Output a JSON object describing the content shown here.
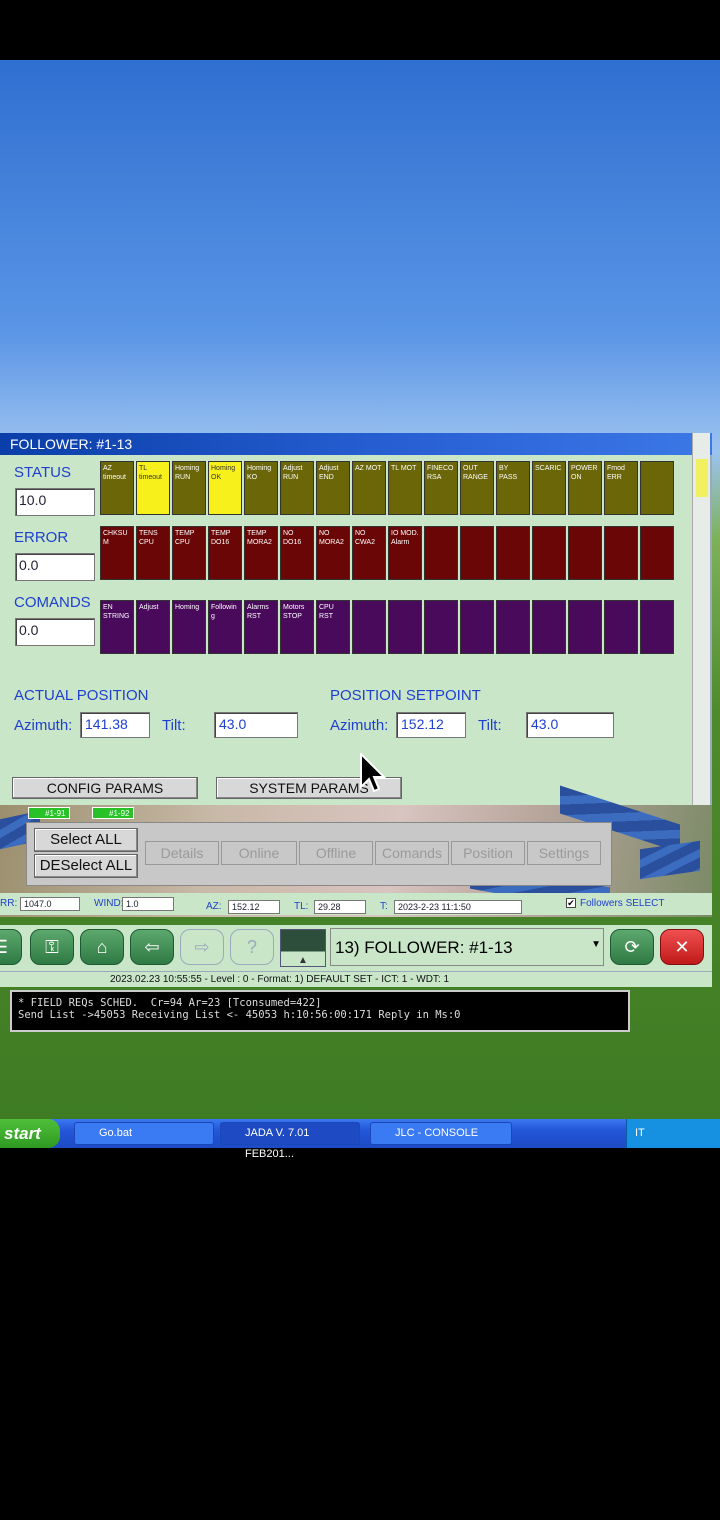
{
  "window": {
    "title": "FOLLOWER: #1-13"
  },
  "status": {
    "label": "STATUS",
    "value": "10.0",
    "cells": [
      {
        "text": "AZ timeout",
        "on": false
      },
      {
        "text": "TL timeout",
        "on": true
      },
      {
        "text": "Homing RUN",
        "on": false
      },
      {
        "text": "Homing OK",
        "on": true
      },
      {
        "text": "Homing KO",
        "on": false
      },
      {
        "text": "Adjust RUN",
        "on": false
      },
      {
        "text": "Adjust END",
        "on": false
      },
      {
        "text": "AZ MOT",
        "on": false
      },
      {
        "text": "TL MOT",
        "on": false
      },
      {
        "text": "FINECO RSA",
        "on": false
      },
      {
        "text": "OUT RANGE",
        "on": false
      },
      {
        "text": "BY PASS",
        "on": false
      },
      {
        "text": "SCARIC",
        "on": false
      },
      {
        "text": "POWER ON",
        "on": false
      },
      {
        "text": "Fmod ERR",
        "on": false
      },
      {
        "text": "",
        "on": false
      }
    ]
  },
  "error": {
    "label": "ERROR",
    "value": "0.0",
    "cells": [
      "CHKSU M",
      "TENS CPU",
      "TEMP CPU",
      "TEMP DO16",
      "TEMP MORA2",
      "NO DO16",
      "NO MORA2",
      "NO CWA2",
      "IO MOD. Alarm",
      "",
      "",
      "",
      "",
      "",
      "",
      ""
    ]
  },
  "commands": {
    "label": "COMANDS",
    "value": "0.0",
    "cells": [
      "EN STRING",
      "Adjust",
      "Homing",
      "Followin g",
      "Alarms RST",
      "Motors STOP",
      "CPU RST",
      "",
      "",
      "",
      "",
      "",
      "",
      "",
      "",
      ""
    ]
  },
  "actual": {
    "label": "ACTUAL POSITION",
    "az_label": "Azimuth:",
    "azimuth": "141.38",
    "tilt_label": "Tilt:",
    "tilt": "43.0"
  },
  "setpoint": {
    "label": "POSITION SETPOINT",
    "az_label": "Azimuth:",
    "azimuth": "152.12",
    "tilt_label": "Tilt:",
    "tilt": "43.0"
  },
  "buttons": {
    "config": "CONFIG PARAMS",
    "system": "SYSTEM PARAMS"
  },
  "tags": [
    "#1-91",
    "#1-92"
  ],
  "strip": {
    "select_all": "Select ALL",
    "deselect_all": "DESelect ALL",
    "tabs": [
      "Details",
      "Online",
      "Offline",
      "Comands",
      "Position",
      "Settings"
    ]
  },
  "info": {
    "rr_label": "RR:",
    "rr": "1047.0",
    "wind_label": "WIND:",
    "wind": "1.0",
    "az_label": "AZ:",
    "az": "152.12",
    "tl_label": "TL:",
    "tl": "29.28",
    "t_label": "T:",
    "t": "2023-2-23 11:1:50",
    "followers_select": "Followers SELECT"
  },
  "nav": {
    "follower_select": "13) FOLLOWER: #1-13"
  },
  "statusline": "2023.02.23   10:55:55 - Level : 0 - Format: 1) DEFAULT SET - ICT: 1 - WDT: 1",
  "console": {
    "line1": "* FIELD REQs SCHED.  Cr=94 Ar=23 [Tconsumed=422]",
    "line2": "Send List ->45053 Receiving List <- 45053 h:10:56:00:171 Reply in Ms:0"
  },
  "taskbar": {
    "start": "start",
    "items": [
      "Go.bat",
      "JADA V. 7.01 FEB201...",
      "JLC - CONSOLE"
    ],
    "lang": "IT"
  }
}
